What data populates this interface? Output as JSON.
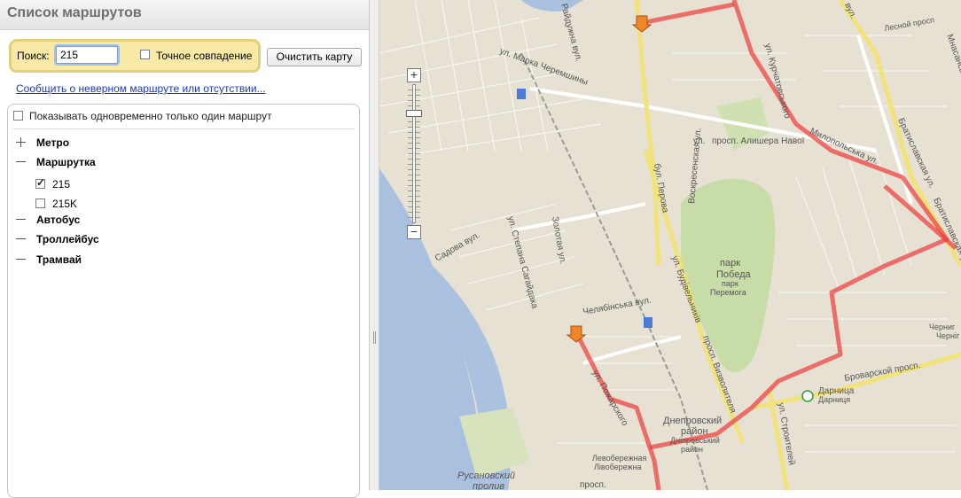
{
  "panel": {
    "title": "Список маршрутов",
    "search_label": "Поиск:",
    "search_value": "215",
    "exact_match_label": "Точное совпадение",
    "exact_match_checked": false,
    "clear_button": "Очистить карту",
    "report_link": "Сообщить о неверном маршруте или отсутствии...",
    "one_route_label": "Показывать одновременно только один маршрут",
    "one_route_checked": false,
    "categories": [
      {
        "label": "Метро",
        "expanded": false
      },
      {
        "label": "Маршрутка",
        "expanded": true
      },
      {
        "label": "Автобус",
        "expanded": true
      },
      {
        "label": "Троллейбус",
        "expanded": true
      },
      {
        "label": "Трамвай",
        "expanded": true
      }
    ],
    "routes": [
      {
        "label": "215",
        "checked": true
      },
      {
        "label": "215K",
        "checked": false
      }
    ]
  },
  "map": {
    "route_color": "#ee3b3b",
    "labels": {
      "l1": "ул. Марка Черемшины",
      "l2": "Райдужна вул.",
      "l3": "просп. Алишера Навої",
      "l4": "ул.",
      "l5": "бул. Перова",
      "l6": "Воскресенская ул.",
      "l7": "парк",
      "l8": "Победа",
      "l9": "парк",
      "l10": "Перемога",
      "l11": "Садова вул.",
      "l12": "ул. Степана Сагайдака",
      "l13": "Золотая ул.",
      "l14": "Челябінська вул.",
      "l15": "ул. Будівельників",
      "l16": "просп. Визволителя",
      "l17": "ул. Пожарского",
      "l18": "Днепровский",
      "l19": "район",
      "l20": "Дніпровський",
      "l21": "район",
      "l22": "Левобережная",
      "l23": "Лівобережна",
      "l24": "Русановский",
      "l25": "пролив",
      "l26": "просп.",
      "l27": "Броварской просп.",
      "l28": "Дарница",
      "l29": "Дарниця",
      "l30": "ул. Строителей",
      "l31": "Черниг",
      "l32": "Черніг",
      "l33": "Лесной просп",
      "l34": "ул. Курчатовського",
      "l35": "Милопольська ул.",
      "l36": "Братиславская ул.",
      "l37": "Братиславская ул.",
      "l38": "вул.",
      "l39": "Мнасанська"
    }
  }
}
